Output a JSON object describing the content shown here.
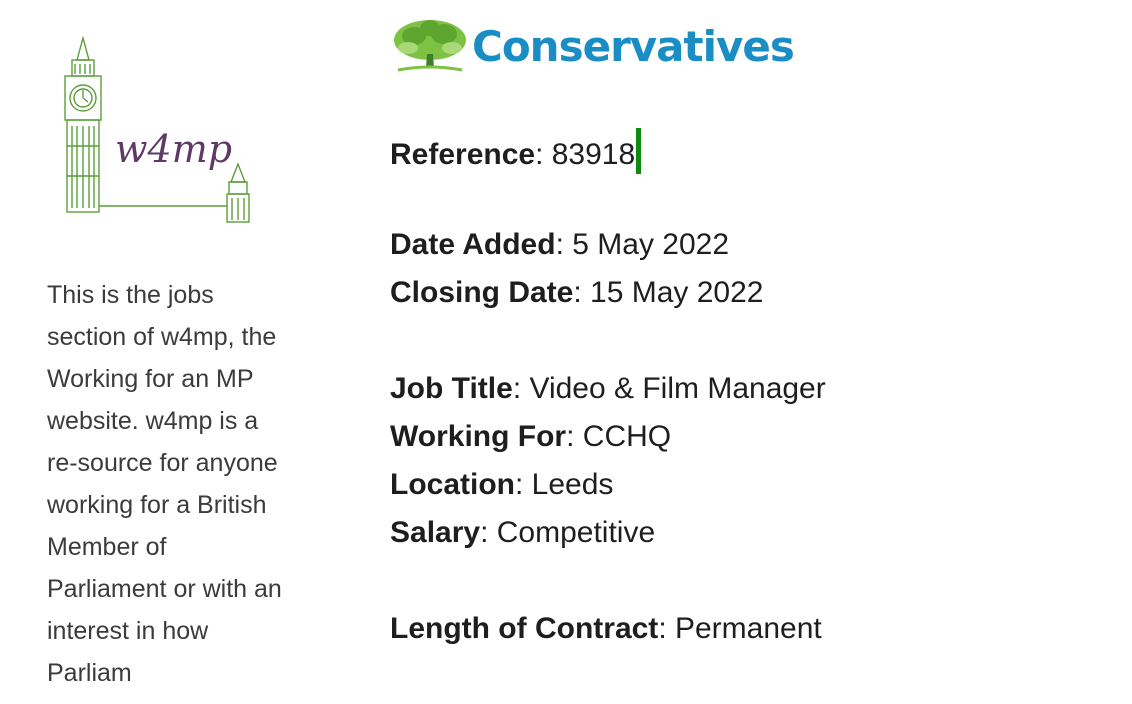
{
  "sidebar": {
    "logo_text": "w4mp",
    "intro": "This is the jobs section of w4mp, the Working for an MP website. w4mp is a re-source for anyone working for a British Member of Parliament or with an interest in how Parliam"
  },
  "header": {
    "party_name": "Conservatives",
    "brand_color": "#1a8dc4",
    "tree_color": "#7dc242"
  },
  "job": {
    "reference": {
      "label": "Reference",
      "value": "83918"
    },
    "date_added": {
      "label": "Date Added",
      "value": "5 May 2022"
    },
    "closing_date": {
      "label": "Closing Date",
      "value": "15 May 2022"
    },
    "job_title": {
      "label": "Job Title",
      "value": "Video & Film Manager"
    },
    "working_for": {
      "label": "Working For",
      "value": "CCHQ"
    },
    "location": {
      "label": "Location",
      "value": "Leeds"
    },
    "salary": {
      "label": "Salary",
      "value": "Competitive"
    },
    "contract": {
      "label": "Length of Contract",
      "value": "Permanent"
    }
  },
  "separator": ": "
}
